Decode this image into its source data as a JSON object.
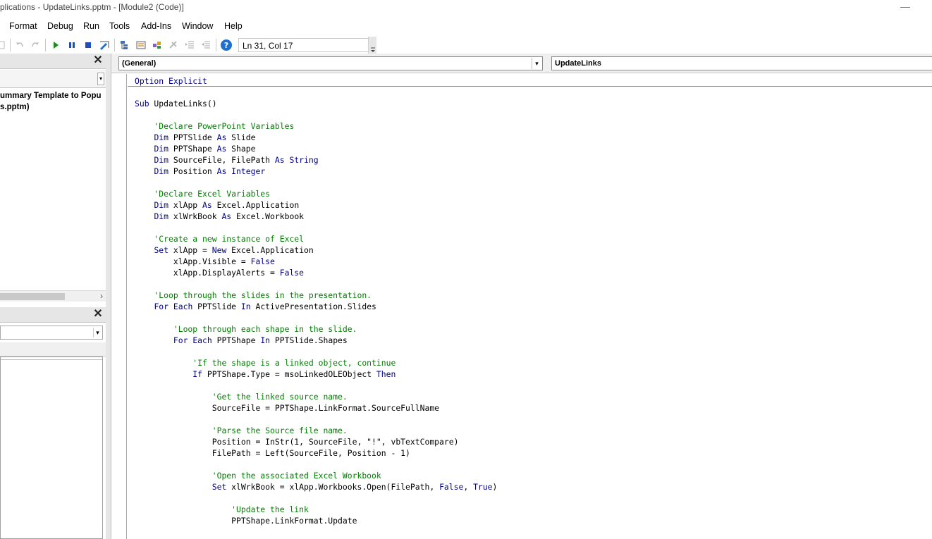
{
  "window": {
    "title": "plications - UpdateLinks.pptm - [Module2 (Code)]",
    "minimize_glyph": "—"
  },
  "menu": {
    "items": [
      "Format",
      "Debug",
      "Run",
      "Tools",
      "Add-Ins",
      "Window",
      "Help"
    ]
  },
  "toolbar": {
    "status": "Ln 31, Col 17",
    "icons": [
      "undo-icon",
      "redo-icon",
      "run-icon",
      "break-icon",
      "reset-icon",
      "design-mode-icon",
      "project-explorer-icon",
      "properties-icon",
      "object-browser-icon",
      "toolbox-icon",
      "indent-icon",
      "outdent-icon",
      "help-icon"
    ]
  },
  "project_pane": {
    "close_glyph": "✕",
    "tree_line1": "ummary Template to Popu",
    "tree_line2": "s.pptm)"
  },
  "properties_pane": {
    "close_glyph": "✕"
  },
  "code_window": {
    "object_combo": "(General)",
    "procedure_combo": "UpdateLinks",
    "lines": [
      {
        "text": "Option Explicit",
        "kind": "keyword"
      },
      {
        "text": "Sub UpdateLinks()",
        "kind": "mixed"
      },
      {
        "text": "    'Declare PowerPoint Variables",
        "kind": "comment"
      },
      {
        "text": "    Dim PPTSlide As Slide",
        "kind": "mixed"
      },
      {
        "text": "    Dim PPTShape As Shape",
        "kind": "mixed"
      },
      {
        "text": "    Dim SourceFile, FilePath As String",
        "kind": "mixed"
      },
      {
        "text": "    Dim Position As Integer",
        "kind": "mixed"
      },
      {
        "text": "    'Declare Excel Variables",
        "kind": "comment"
      },
      {
        "text": "    Dim xlApp As Excel.Application",
        "kind": "mixed"
      },
      {
        "text": "    Dim xlWrkBook As Excel.Workbook",
        "kind": "mixed"
      },
      {
        "text": "    'Create a new instance of Excel",
        "kind": "comment"
      },
      {
        "text": "    Set xlApp = New Excel.Application",
        "kind": "mixed"
      },
      {
        "text": "        xlApp.Visible = False",
        "kind": "mixed"
      },
      {
        "text": "        xlApp.DisplayAlerts = False",
        "kind": "mixed"
      },
      {
        "text": "    'Loop through the slides in the presentation.",
        "kind": "comment"
      },
      {
        "text": "    For Each PPTSlide In ActivePresentation.Slides",
        "kind": "mixed"
      },
      {
        "text": "        'Loop through each shape in the slide.",
        "kind": "comment"
      },
      {
        "text": "        For Each PPTShape In PPTSlide.Shapes",
        "kind": "mixed"
      },
      {
        "text": "            'If the shape is a linked object, continue",
        "kind": "comment"
      },
      {
        "text": "            If PPTShape.Type = msoLinkedOLEObject Then",
        "kind": "mixed"
      },
      {
        "text": "                'Get the linked source name.",
        "kind": "comment"
      },
      {
        "text": "                SourceFile = PPTShape.LinkFormat.SourceFullName",
        "kind": "plain"
      },
      {
        "text": "                'Parse the Source file name.",
        "kind": "comment"
      },
      {
        "text": "                Position = InStr(1, SourceFile, \"!\", vbTextCompare)",
        "kind": "plain"
      },
      {
        "text": "                FilePath = Left(SourceFile, Position - 1)",
        "kind": "plain"
      },
      {
        "text": "                'Open the associated Excel Workbook",
        "kind": "comment"
      },
      {
        "text": "                Set xlWrkBook = xlApp.Workbooks.Open(FilePath, False, True)",
        "kind": "mixed"
      },
      {
        "text": "                    'Update the link",
        "kind": "comment"
      },
      {
        "text": "                    PPTShape.LinkFormat.Update",
        "kind": "plain"
      }
    ]
  },
  "colors": {
    "keyword": "#00008b",
    "comment": "#008000",
    "help_icon": "#1e6fd0"
  }
}
